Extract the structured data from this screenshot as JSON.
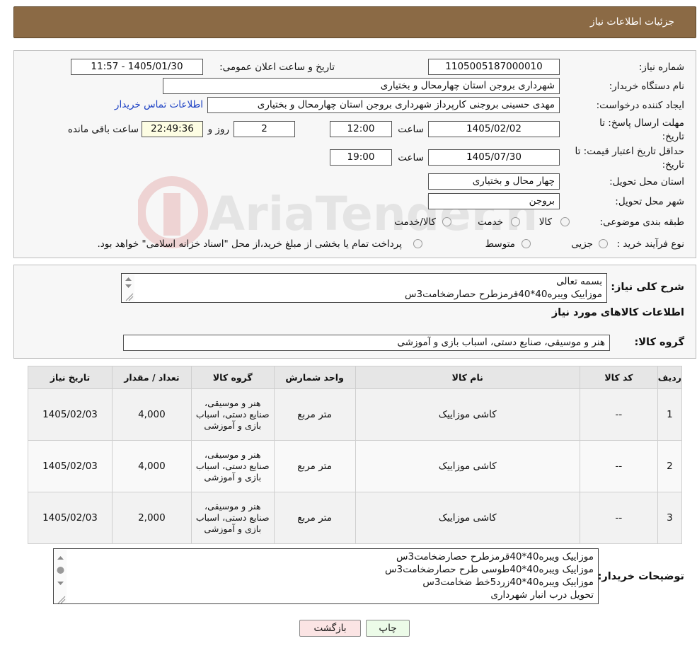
{
  "header": {
    "title": "جزئیات اطلاعات نیاز"
  },
  "form": {
    "need_number_label": "شماره نیاز:",
    "need_number": "1105005187000010",
    "announce_label": "تاریخ و ساعت اعلان عمومی:",
    "announce_value": "1405/01/30 - 11:57",
    "buyer_org_label": "نام دستگاه خریدار:",
    "buyer_org": "شهرداری بروجن استان چهارمحال و بختیاری",
    "creator_label": "ایجاد کننده درخواست:",
    "creator": "مهدی حسینی بروجنی کارپرداز شهرداری بروجن استان چهارمحال و بختیاری",
    "contact_link": "اطلاعات تماس خریدار",
    "reply_deadline_label": "مهلت ارسال پاسخ: تا تاریخ:",
    "reply_date": "1405/02/02",
    "time_label": "ساعت",
    "reply_time": "12:00",
    "days_value": "2",
    "days_label": "روز و",
    "remaining_time": "22:49:36",
    "remaining_label": "ساعت باقی مانده",
    "price_validity_label": "حداقل تاریخ اعتبار قیمت: تا تاریخ:",
    "price_date": "1405/07/30",
    "price_time": "19:00",
    "province_label": "استان محل تحویل:",
    "province": "چهار محال و بختیاری",
    "city_label": "شهر محل تحویل:",
    "city": "بروجن",
    "category_label": "طبقه بندی موضوعی:",
    "category_options": [
      "کالا",
      "خدمت",
      "کالا/خدمت"
    ],
    "purchase_label": "نوع فرآیند خرید :",
    "purchase_options": [
      "جزیی",
      "متوسط"
    ],
    "purchase_note": "پرداخت تمام یا بخشی از مبلغ خرید،از محل \"اسناد خزانه اسلامی\" خواهد بود."
  },
  "watermark": {
    "text": "AriaTender.neT"
  },
  "summary": {
    "label": "شرح کلی نیاز:",
    "lines": [
      "بسمه تعالی",
      "موزاییک ویبره40*40قرمزطرح حصارضخامت3س"
    ],
    "goods_info_title": "اطلاعات کالاهای مورد نیاز",
    "group_label": "گروه کالا:",
    "group_value": "هنر و موسیقی، صنایع دستی، اسباب بازی و آموزشی"
  },
  "table": {
    "headers": [
      "ردیف",
      "کد کالا",
      "نام کالا",
      "واحد شمارش",
      "گروه کالا",
      "تعداد / مقدار",
      "تاریخ نیاز"
    ],
    "rows": [
      {
        "row": "1",
        "code": "--",
        "name": "کاشی موزاییک",
        "unit": "متر مربع",
        "group": "هنر و موسیقی، صنایع دستی، اسباب بازی و آموزشی",
        "qty": "4,000",
        "date": "1405/02/03"
      },
      {
        "row": "2",
        "code": "--",
        "name": "کاشی موزاییک",
        "unit": "متر مربع",
        "group": "هنر و موسیقی، صنایع دستی، اسباب بازی و آموزشی",
        "qty": "4,000",
        "date": "1405/02/03"
      },
      {
        "row": "3",
        "code": "--",
        "name": "کاشی موزاییک",
        "unit": "متر مربع",
        "group": "هنر و موسیقی، صنایع دستی، اسباب بازی و آموزشی",
        "qty": "2,000",
        "date": "1405/02/03"
      }
    ]
  },
  "buyer_notes": {
    "label": "توضیحات خریدار:",
    "lines": [
      "موزاییک ویبره40*40قرمزطرح حصارضخامت3س",
      "موزاییک ویبره40*40طوسی طرح حصارضخامت3س",
      "موزاییک ویبره40*40زرد5خط ضخامت3س",
      "تحویل درب انبار شهرداری"
    ]
  },
  "buttons": {
    "print": "چاپ",
    "back": "بازگشت"
  }
}
